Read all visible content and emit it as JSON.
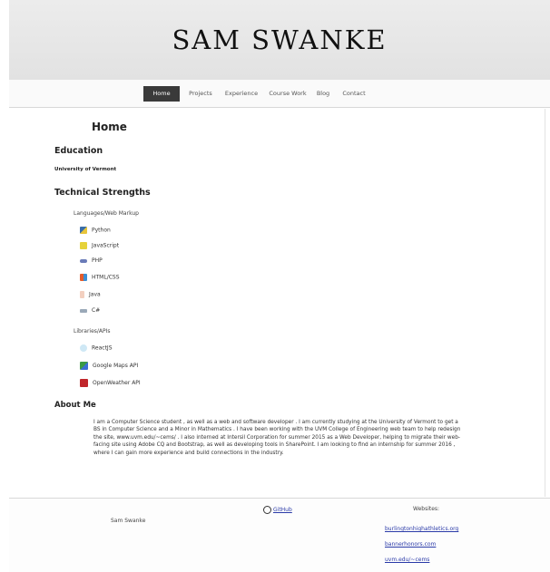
{
  "site": {
    "title": "SAM SWANKE"
  },
  "nav": {
    "items": [
      "Home",
      "Projects",
      "Experience",
      "Course Work",
      "Blog",
      "Contact"
    ],
    "active": "Home"
  },
  "main": {
    "heading": "Home",
    "education_heading": "Education",
    "university": "University of Vermont",
    "tech_heading": "Technical Strengths",
    "languages_label": "Languages/Web Markup",
    "languages": [
      {
        "name": "Python",
        "icon": "python-icon"
      },
      {
        "name": "JavaScript",
        "icon": "javascript-icon"
      },
      {
        "name": "PHP",
        "icon": "php-icon"
      },
      {
        "name": "HTML/CSS",
        "icon": "html-css-icon"
      },
      {
        "name": "Java",
        "icon": "java-icon"
      },
      {
        "name": "C#",
        "icon": "csharp-icon"
      }
    ],
    "libraries_label": "Libraries/APIs",
    "libraries": [
      {
        "name": "ReactJS",
        "icon": "react-icon"
      },
      {
        "name": "Google Maps API",
        "icon": "google-maps-icon"
      },
      {
        "name": "OpenWeather API",
        "icon": "openweather-icon"
      }
    ],
    "about_heading": "About Me",
    "about_text": "I am a Computer Science student , as well as a web and software developer . I am currently studying at the University of Vermont to get a BS in Computer Science and a Minor in Mathematics . I have been working with the UVM College of Engineering web team to help redesign the site, www.uvm.edu/~cems/ . I also interned at Intersil Corporation for summer 2015 as a Web Developer, helping to migrate their web-facing site using Adobe CQ and Bootstrap, as well as developing tools in SharePoint. I am looking to find an internship for summer 2016 , where I can gain more experience and build connections in the industry."
  },
  "footer": {
    "name": "Sam Swanke",
    "github": "GitHub",
    "websites_label": "Websites:",
    "links": [
      "burlingtonhighathletics.org",
      "bannerhonors.com",
      "uvm.edu/~cems"
    ]
  },
  "colors": {
    "nav_active_bg": "#3a3a3a",
    "link": "#2a3aa8",
    "header_bg": "#e6e6e6"
  }
}
